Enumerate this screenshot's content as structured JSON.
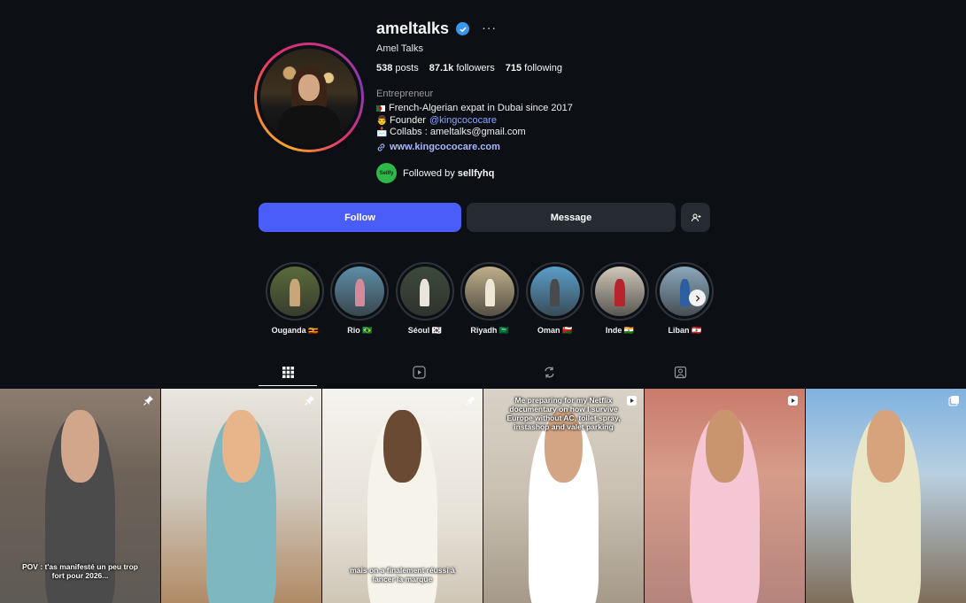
{
  "profile": {
    "username": "ameltalks",
    "full_name": "Amel Talks",
    "more_label": "···",
    "stats": [
      {
        "value": "538",
        "label": "posts"
      },
      {
        "value": "87.1k",
        "label": "followers"
      },
      {
        "value": "715",
        "label": "following"
      }
    ],
    "category": "Entrepreneur",
    "bio": {
      "line1": "French-Algerian expat in Dubai since 2017",
      "line2_prefix": "Founder ",
      "line2_mention": "@kingcococare",
      "line3": "Collabs : ameltalks@gmail.com"
    },
    "website": "www.kingcococare.com",
    "followed_by_prefix": "Followed by ",
    "followed_by_user": "sellfyhq",
    "followed_by_avatar_text": "Sellfy"
  },
  "actions": {
    "follow": "Follow",
    "message": "Message"
  },
  "highlights": [
    {
      "label": "Ouganda 🇺🇬",
      "bg": "#5a6a3a",
      "fig": "#c8a67a"
    },
    {
      "label": "Rio 🇧🇷",
      "bg": "#5d8ea8",
      "fig": "#d58a9a"
    },
    {
      "label": "Séoul 🇰🇷",
      "bg": "#3d4a3b",
      "fig": "#e9e4dc"
    },
    {
      "label": "Riyadh 🇸🇦",
      "bg": "#bfae8a",
      "fig": "#efe6d4"
    },
    {
      "label": "Oman 🇴🇲",
      "bg": "#5b9fc9",
      "fig": "#4a4a4a"
    },
    {
      "label": "Inde 🇮🇳",
      "bg": "#cfc7b8",
      "fig": "#b8242b"
    },
    {
      "label": "Liban 🇱🇧",
      "bg": "#8aa7bb",
      "fig": "#2d5fa0"
    }
  ],
  "tabs": [
    "posts-grid",
    "reels",
    "reposts",
    "tagged"
  ],
  "posts": [
    {
      "caption": "POV : t'as manifesté un peu trop fort pour 2026...",
      "badge": "pin",
      "bg": "linear-gradient(180deg,#8d7d70 0%,#6e6258 40%,#5e5a55 100%)",
      "fig": "#4b4b4b",
      "skin": "#d2a68a"
    },
    {
      "caption": "",
      "badge": "pin",
      "bg": "linear-gradient(180deg,#e9e6df 0%,#cfc8bc 50%,#b08a65 100%)",
      "fig": "#7fb7c0",
      "skin": "#e8b58a"
    },
    {
      "caption": "mais on a finalement réussi à lancer la marque",
      "badge": "pin",
      "bg": "linear-gradient(180deg,#f5f3ef 0%,#e7e2d8 60%,#cfc6b6 100%)",
      "fig": "#f6f3ea",
      "skin": "#6b4a34"
    },
    {
      "caption": "Me preparing for my Netflix documentary on how I survive Europe without AC, toilet spray, instashop and valet parking",
      "badge": "reel",
      "bg": "linear-gradient(180deg,#d8d2c7 0%,#c9c0b1 50%,#a59a8a 100%)",
      "fig": "#ffffff",
      "skin": "#d4a584"
    },
    {
      "caption": "",
      "badge": "reel",
      "bg": "linear-gradient(180deg,#c97b6c 0%,#d69c8a 40%,#b5847d 100%)",
      "fig": "#f5c6d3",
      "skin": "#c8956f"
    },
    {
      "caption": "",
      "badge": "carousel",
      "bg": "linear-gradient(180deg,#7fb2df 0%,#b9cfe0 40%,#7e6e5a 100%)",
      "fig": "#e9e7c8",
      "skin": "#d7a37c"
    }
  ]
}
